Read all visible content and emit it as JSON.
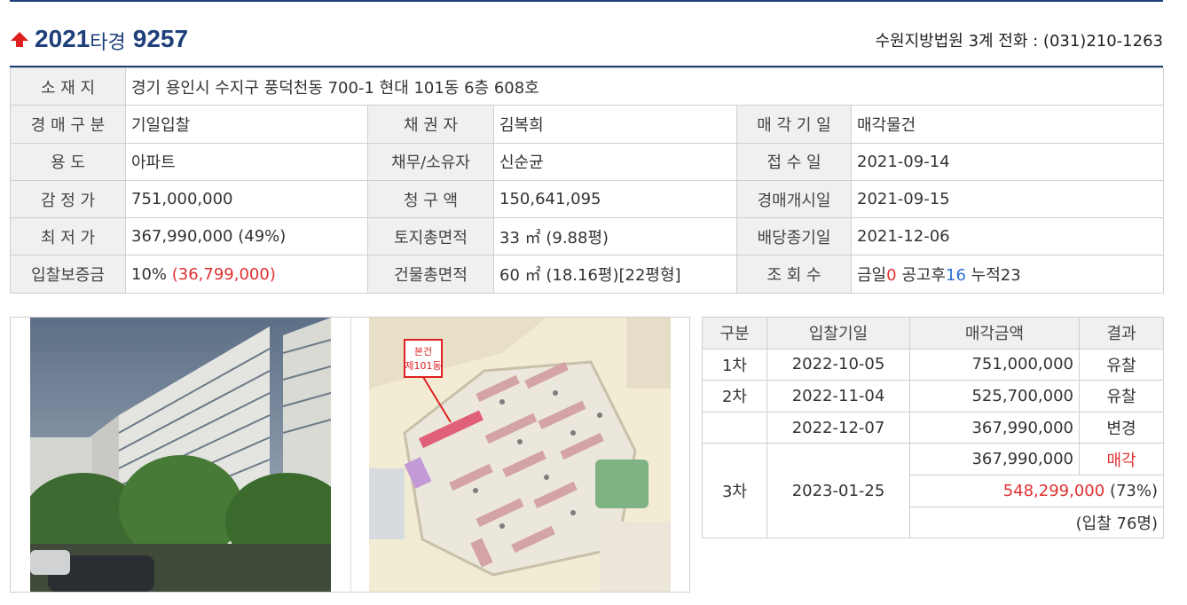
{
  "header": {
    "case_year": "2021",
    "case_kind": "타경",
    "case_number": "9257",
    "court_info": "수원지방법원 3계 전화 : (031)210-1263"
  },
  "info": {
    "address_label": "소 재 지",
    "address": "경기 용인시 수지구 풍덕천동 700-1 현대 101동 6층 608호",
    "auction_type_label": "경 매 구 분",
    "auction_type": "기일입찰",
    "creditor_label": "채 권 자",
    "creditor": "김복희",
    "sale_date_label": "매 각 기 일",
    "sale_date": "매각물건",
    "use_label": "용 도",
    "use": "아파트",
    "debtor_label": "채무/소유자",
    "debtor": "신순균",
    "receipt_date_label": "접 수 일",
    "receipt_date": "2021-09-14",
    "appraisal_label": "감 정 가",
    "appraisal": "751,000,000",
    "claim_label": "청 구 액",
    "claim": "150,641,095",
    "start_date_label": "경매개시일",
    "start_date": "2021-09-15",
    "minimum_label": "최 저 가",
    "minimum": "367,990,000 (49%)",
    "land_area_label": "토지총면적",
    "land_area": "33 ㎡ (9.88평)",
    "dividend_end_label": "배당종기일",
    "dividend_end": "2021-12-06",
    "deposit_label": "입찰보증금",
    "deposit_pct": "10%",
    "deposit_amount": "(36,799,000)",
    "building_area_label": "건물총면적",
    "building_area": "60 ㎡ (18.16평)[22평형]",
    "views_label": "조 회 수",
    "views_today_label": "금일",
    "views_today": "0",
    "views_after_label": "공고후",
    "views_after": "16",
    "views_total_label": "누적",
    "views_total": "23"
  },
  "map": {
    "callout_line1": "본건",
    "callout_line2": "제101동"
  },
  "history": {
    "headers": [
      "구분",
      "입찰기일",
      "매각금액",
      "결과"
    ],
    "rows": [
      {
        "round": "1차",
        "date": "2022-10-05",
        "amount": "751,000,000",
        "result": "유찰"
      },
      {
        "round": "2차",
        "date": "2022-11-04",
        "amount": "525,700,000",
        "result": "유찰"
      },
      {
        "round": "",
        "date": "2022-12-07",
        "amount": "367,990,000",
        "result": "변경"
      },
      {
        "round": "3차",
        "date": "2023-01-25",
        "amount": "367,990,000",
        "result": "매각"
      }
    ],
    "sold_price": "548,299,000",
    "sold_ratio": "(73%)",
    "bidders": "(입찰 76명)"
  },
  "colors": {
    "brand_navy": "#1e3f7a",
    "accent_red": "#e03030",
    "accent_blue": "#2a6fd0",
    "label_bg": "#f0f0f0"
  }
}
